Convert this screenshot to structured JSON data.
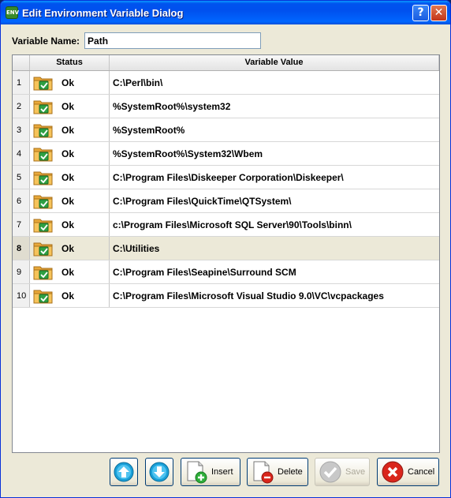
{
  "window": {
    "title": "Edit Environment Variable Dialog",
    "icon_text": "ENV",
    "help_label": "?",
    "close_label": "✕"
  },
  "variable": {
    "label": "Variable Name:",
    "value": "Path"
  },
  "table": {
    "headers": {
      "status": "Status",
      "value": "Variable Value"
    },
    "selected_index": 8,
    "rows": [
      {
        "index": "1",
        "status": "Ok",
        "value": "C:\\Perl\\bin\\"
      },
      {
        "index": "2",
        "status": "Ok",
        "value": "%SystemRoot%\\system32"
      },
      {
        "index": "3",
        "status": "Ok",
        "value": "%SystemRoot%"
      },
      {
        "index": "4",
        "status": "Ok",
        "value": "%SystemRoot%\\System32\\Wbem"
      },
      {
        "index": "5",
        "status": "Ok",
        "value": "C:\\Program Files\\Diskeeper Corporation\\Diskeeper\\"
      },
      {
        "index": "6",
        "status": "Ok",
        "value": "C:\\Program Files\\QuickTime\\QTSystem\\"
      },
      {
        "index": "7",
        "status": "Ok",
        "value": "c:\\Program Files\\Microsoft SQL Server\\90\\Tools\\binn\\"
      },
      {
        "index": "8",
        "status": "Ok",
        "value": "C:\\Utilities"
      },
      {
        "index": "9",
        "status": "Ok",
        "value": "C:\\Program Files\\Seapine\\Surround SCM"
      },
      {
        "index": "10",
        "status": "Ok",
        "value": "C:\\Program Files\\Microsoft Visual Studio 9.0\\VC\\vcpackages"
      }
    ]
  },
  "buttons": {
    "move_up_icon": "arrow-up-icon",
    "move_down_icon": "arrow-down-icon",
    "insert": "Insert",
    "delete": "Delete",
    "save": "Save",
    "cancel": "Cancel"
  },
  "colors": {
    "title_bar": "#0053ee",
    "ok_check": "#2ea043",
    "cancel_red": "#d9261c"
  }
}
